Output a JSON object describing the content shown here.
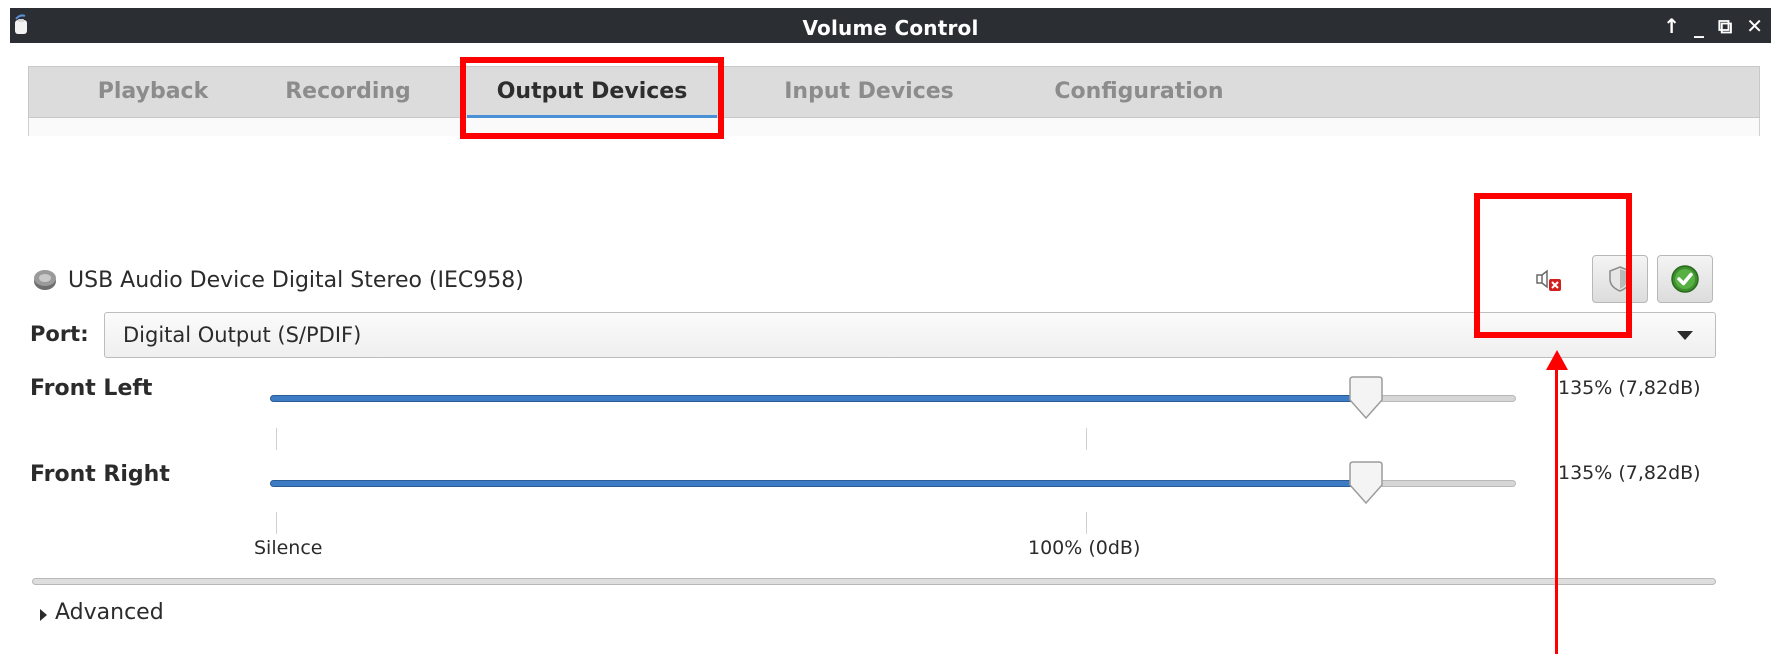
{
  "window": {
    "title": "Volume Control",
    "buttons": [
      "↑",
      "_",
      "⧉",
      "✕"
    ]
  },
  "tabs": [
    {
      "label": "Playback",
      "active": false
    },
    {
      "label": "Recording",
      "active": false
    },
    {
      "label": "Output Devices",
      "active": true
    },
    {
      "label": "Input Devices",
      "active": false
    },
    {
      "label": "Configuration",
      "active": false
    }
  ],
  "device": {
    "name": "USB Audio Device Digital Stereo (IEC958)",
    "muted": true,
    "icons": {
      "device": "speaker-icon",
      "mute": "mute-icon",
      "lock": "lock-channels-icon",
      "default": "set-default-icon"
    }
  },
  "port": {
    "label": "Port:",
    "value": "Digital Output (S/PDIF)"
  },
  "channels": [
    {
      "name": "Front Left",
      "value_text": "135% (7,82dB)",
      "level_fraction": 0.88
    },
    {
      "name": "Front Right",
      "value_text": "135% (7,82dB)",
      "level_fraction": 0.88
    }
  ],
  "scale": {
    "silence": "Silence",
    "reference": "100% (0dB)"
  },
  "advanced": {
    "label": "Advanced"
  },
  "colors": {
    "titlebar": "#2b2e33",
    "accent": "#4a90d9",
    "highlight": "#ff0000",
    "slider_fill": "#3d7cc4"
  }
}
